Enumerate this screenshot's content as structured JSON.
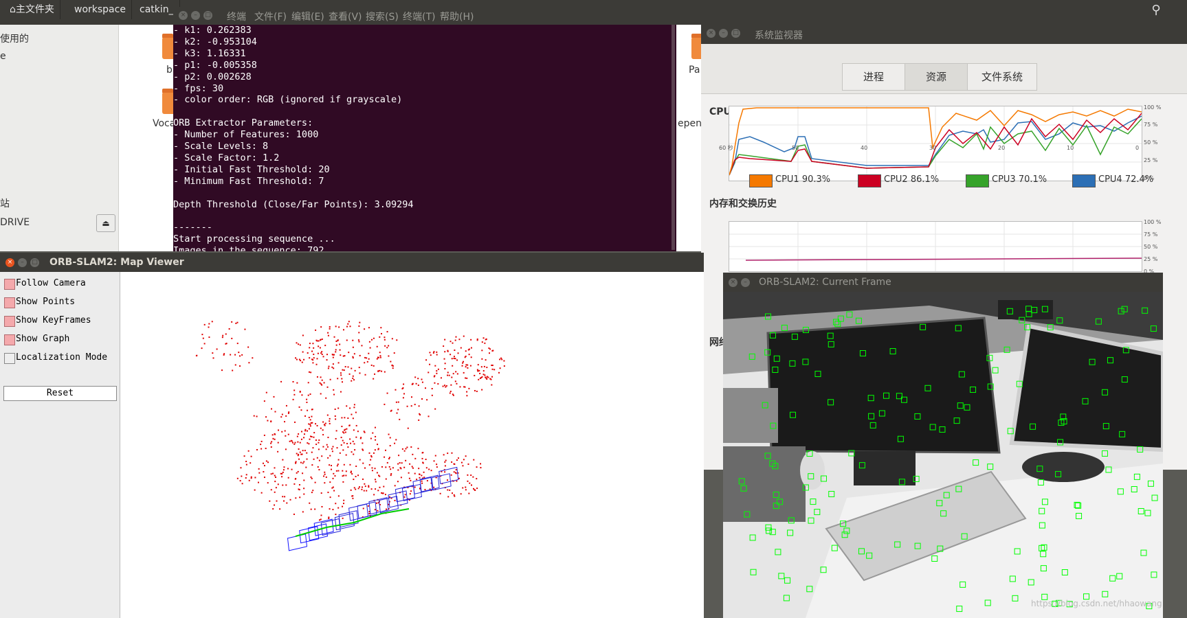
{
  "file_manager": {
    "tabs": [
      "主文件夹",
      "workspace",
      "catkin_"
    ],
    "sidebar": [
      "使用的",
      "e",
      "站",
      "DRIVE"
    ],
    "folders": [
      "b",
      "Voca",
      "Pa",
      "epenc"
    ],
    "eject_icon": "eject-icon",
    "search_icon": "search-icon"
  },
  "terminal": {
    "menu": [
      "终端",
      "文件(F)",
      "编辑(E)",
      "查看(V)",
      "搜索(S)",
      "终端(T)",
      "帮助(H)"
    ],
    "lines": [
      "- k1: 0.262383",
      "- k2: -0.953104",
      "- k3: 1.16331",
      "- p1: -0.005358",
      "- p2: 0.002628",
      "- fps: 30",
      "- color order: RGB (ignored if grayscale)",
      "",
      "ORB Extractor Parameters:",
      "- Number of Features: 1000",
      "- Scale Levels: 8",
      "- Scale Factor: 1.2",
      "- Initial Fast Threshold: 20",
      "- Minimum Fast Threshold: 7",
      "",
      "Depth Threshold (Close/Far Points): 3.09294",
      "",
      "-------",
      "Start processing sequence ...",
      "Images in the sequence: 792"
    ]
  },
  "system_monitor": {
    "title": "系统监视器",
    "tabs": [
      "进程",
      "资源",
      "文件系统"
    ],
    "active_tab": "资源",
    "cpu_section": "CPU 历史",
    "mem_section": "内存和交换历史",
    "net_section": "网络",
    "cpu_legend": [
      {
        "label": "CPU1 90.3%",
        "color": "#f57900"
      },
      {
        "label": "CPU2 86.1%",
        "color": "#cc0022"
      },
      {
        "label": "CPU3 70.1%",
        "color": "#36a32a"
      },
      {
        "label": "CPU4 72.4%",
        "color": "#2c6fb5"
      }
    ],
    "x_ticks": [
      "60 秒",
      "50",
      "40",
      "30",
      "20",
      "10",
      "0"
    ],
    "y_ticks": [
      "100 %",
      "75 %",
      "50 %",
      "25 %",
      "0 %"
    ]
  },
  "map_viewer": {
    "title": "ORB-SLAM2: Map Viewer",
    "controls": [
      {
        "label": "Follow Camera",
        "checked": true
      },
      {
        "label": "Show Points",
        "checked": true
      },
      {
        "label": "Show KeyFrames",
        "checked": true
      },
      {
        "label": "Show Graph",
        "checked": true
      },
      {
        "label": "Localization Mode",
        "checked": false
      }
    ],
    "reset_label": "Reset"
  },
  "current_frame": {
    "title": "ORB-SLAM2: Current Frame"
  },
  "watermark": "https://blog.csdn.net/hhaowang"
}
